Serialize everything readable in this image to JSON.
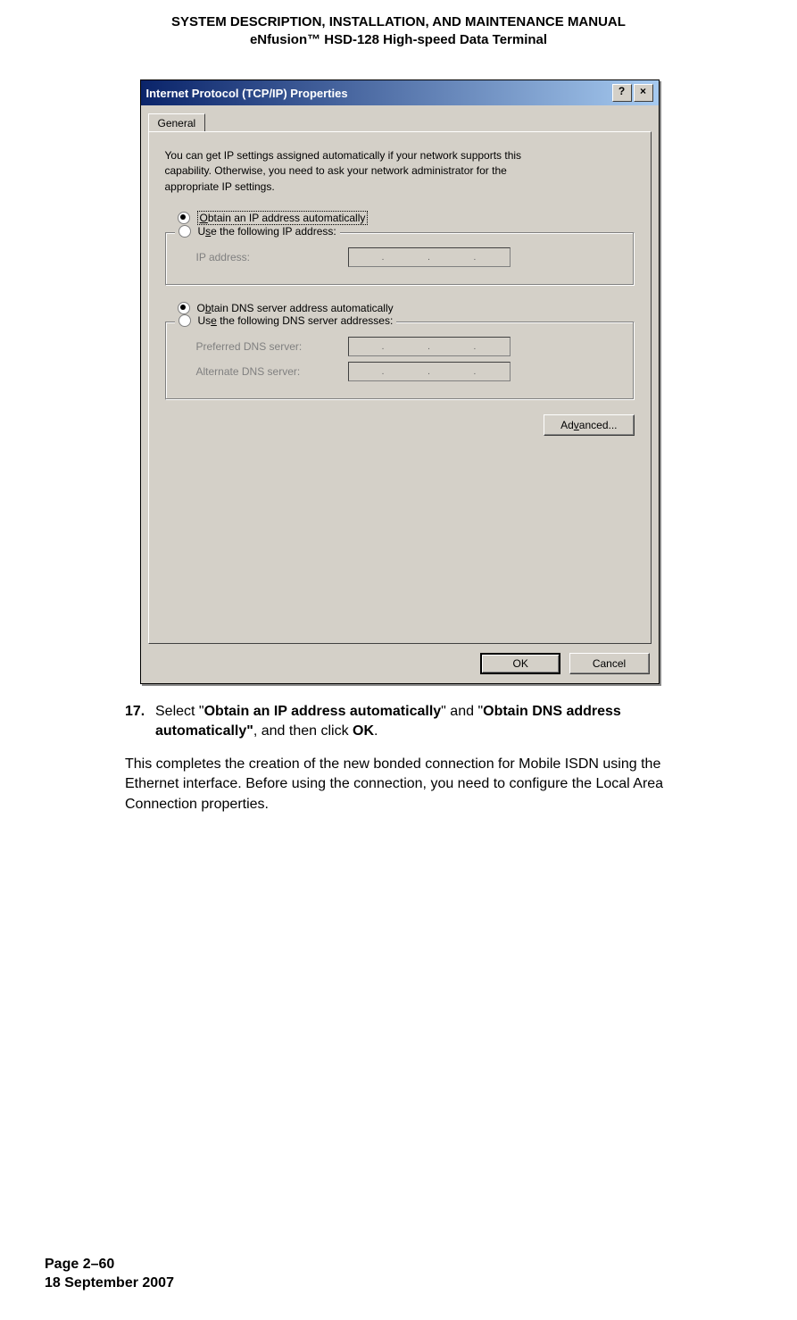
{
  "header": {
    "line1": "SYSTEM DESCRIPTION, INSTALLATION, AND MAINTENANCE MANUAL",
    "line2": "eNfusion™ HSD-128 High-speed Data Terminal"
  },
  "dialog": {
    "title": "Internet Protocol (TCP/IP) Properties",
    "help_btn": "?",
    "close_btn": "×",
    "tab": "General",
    "description": "You can get IP settings assigned automatically if your network supports this capability. Otherwise, you need to ask your network administrator for the appropriate IP settings.",
    "ip_auto_label": "Obtain an IP address automatically",
    "ip_manual_label": "Use the following IP address:",
    "ip_address_label": "IP address:",
    "dns_auto_label": "Obtain DNS server address automatically",
    "dns_manual_label": "Use the following DNS server addresses:",
    "preferred_dns_label": "Preferred DNS server:",
    "alternate_dns_label": "Alternate DNS server:",
    "advanced_btn": "Advanced...",
    "ok_btn": "OK",
    "cancel_btn": "Cancel"
  },
  "step": {
    "num": "17.",
    "prefix": "Select \"",
    "bold1": "Obtain an IP address automatically",
    "mid": "\" and \"",
    "bold2": "Obtain DNS address automatically\"",
    "after": ", and then click ",
    "bold3": "OK",
    "end": "."
  },
  "paragraph": "This completes the creation of the new bonded connection for Mobile ISDN using the Ethernet interface. Before using the connection, you need to configure the Local Area Connection properties.",
  "footer": {
    "page": "Page 2–60",
    "date": "18 September 2007"
  }
}
